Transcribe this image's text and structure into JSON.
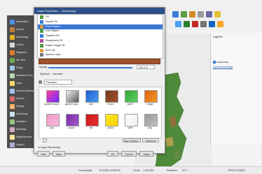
{
  "dialog": {
    "title": "Layer Properties — Symbology",
    "single_symbol_options": [
      {
        "label": "Fill",
        "color": "#4f9c3b"
      },
      {
        "label": "Simple Fill",
        "color": "#2f7ad6"
      },
      {
        "label": "Point Pattern",
        "color": "#e09a3a"
      },
      {
        "label": "Line Pattern",
        "color": "#4f9c3b"
      },
      {
        "label": "Gradient Fill",
        "color": "#2f7ad6"
      },
      {
        "label": "Shapeburst Fill",
        "color": "#b04a9a"
      },
      {
        "label": "Raster Image Fill",
        "color": "#4f9c3b"
      },
      {
        "label": "SVG Fill",
        "color": "#e09a3a"
      },
      {
        "label": "Symbol Layer",
        "color": "#777777"
      }
    ],
    "selected_index": 2,
    "fill_color": "#a0522d",
    "opacity_label": "Opacity",
    "opacity_value": "100.0 %",
    "opacity_fraction": 1.0,
    "tabs": [
      "Symbols",
      "Favorites"
    ],
    "filter_placeholder": "Favorites",
    "ramps": [
      {
        "label": "gradient purple",
        "color_a": "#ff3fa0",
        "color_b": "#6a2cff"
      },
      {
        "label": "gradient gray",
        "color_a": "#f2f2f2",
        "color_b": "#5a5a5a"
      },
      {
        "label": "blue",
        "color_a": "#1e5ad0",
        "color_b": "#4aa0f0"
      },
      {
        "label": "brown",
        "color_a": "#7a3b1c",
        "color_b": "#a0522d"
      },
      {
        "label": "green",
        "color_a": "#2ea83a",
        "color_b": "#60d060"
      },
      {
        "label": "orange",
        "color_a": "#e0600a",
        "color_b": "#f29a2a"
      },
      {
        "label": "pink",
        "color_a": "#f39bc8",
        "color_b": "#f6b6d8"
      },
      {
        "label": "purple",
        "color_a": "#7a2aa0",
        "color_b": "#a45ad0"
      },
      {
        "label": "red",
        "color_a": "#c81818",
        "color_b": "#e83030"
      },
      {
        "label": "yellow",
        "color_a": "#ffe826",
        "color_b": "#ffd000"
      },
      {
        "label": "white",
        "color_a": "#ffffff",
        "color_b": "#eeeeee"
      },
      {
        "label": "gray",
        "color_a": "#9a9a9a",
        "color_b": "#c0c0c0"
      }
    ],
    "grid_buttons": {
      "save": "Save Symbol...",
      "advanced": "Advanced"
    },
    "layer_rendering": "Layer Rendering",
    "buttons": {
      "help": "Help",
      "style": "Style",
      "ok": "OK",
      "cancel": "Cancel",
      "apply": "Apply"
    }
  },
  "sidebar_items": [
    {
      "label": "Information",
      "color": "#4a90e2"
    },
    {
      "label": "Source",
      "color": "#c07a3a"
    },
    {
      "label": "Symbology",
      "color": "#e0b020"
    },
    {
      "label": "Labels",
      "color": "#d9d9d9"
    },
    {
      "label": "Diagrams",
      "color": "#e07a30"
    },
    {
      "label": "3D View",
      "color": "#6aa84f"
    },
    {
      "label": "Fields",
      "color": "#9fc5e8"
    },
    {
      "label": "Attributes Form",
      "color": "#b6d7a8"
    },
    {
      "label": "Joins",
      "color": "#ffd966"
    },
    {
      "label": "Auxiliary Storage",
      "color": "#a4c2f4"
    },
    {
      "label": "Actions",
      "color": "#e06666"
    },
    {
      "label": "Display",
      "color": "#f6b26b"
    },
    {
      "label": "Rendering",
      "color": "#cfe2f3"
    },
    {
      "label": "Variables",
      "color": "#93c47d"
    },
    {
      "label": "Metadata",
      "color": "#d5a6bd"
    },
    {
      "label": "Dependencies",
      "color": "#ffe599"
    },
    {
      "label": "Legend",
      "color": "#b4a7d6"
    }
  ],
  "layers_panel": {
    "title": "Layers",
    "items": [
      {
        "label": "Land Use"
      },
      {
        "label": "OpenStreetMap"
      }
    ]
  },
  "status_bar": {
    "coordinate_label": "Coordinate",
    "coordinate_value": "512345,4789012",
    "scale_label": "Scale",
    "scale_value": "1:45 000",
    "rotation_label": "Rotation",
    "rotation_value": "0.0 °",
    "crs": "EPSG:32633"
  },
  "colors": {
    "dialog_title": "#2b4f86",
    "sidebar": "#4d4d4d",
    "selection": "#3b78d4",
    "map_green": "#4f8a3a"
  }
}
